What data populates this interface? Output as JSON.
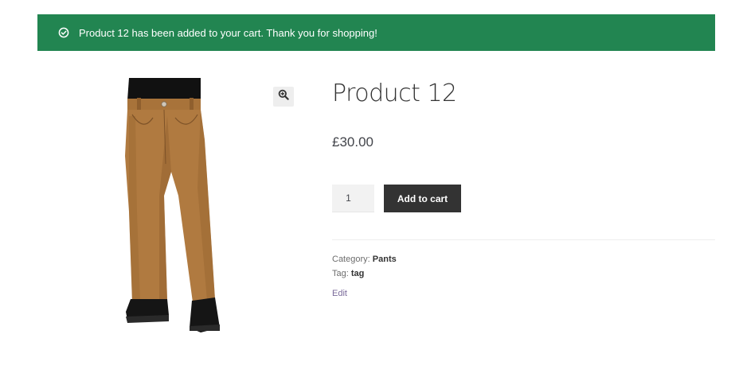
{
  "notice": {
    "message": "Product 12 has been added to your cart. Thank you for shopping!",
    "icon": "check-circle-icon",
    "background": "#228551"
  },
  "product": {
    "title": "Product 12",
    "price": "£30.00",
    "quantity": "1",
    "add_to_cart_label": "Add to cart",
    "image_alt": "brown work pants with black boots",
    "zoom_icon": "zoom-in-icon"
  },
  "meta": {
    "category_label": "Category:",
    "category_value": "Pants",
    "tag_label": "Tag:",
    "tag_value": "tag",
    "edit_label": "Edit"
  }
}
